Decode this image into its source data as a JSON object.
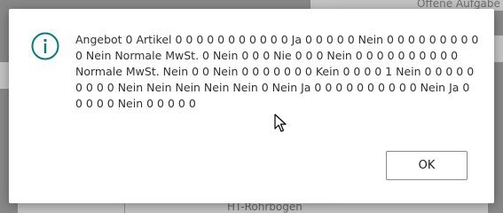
{
  "background": {
    "top_right_text": "Offene Aufgabe",
    "bottom_text": "HT-Rohrbogen"
  },
  "dialog": {
    "icon": "info-icon",
    "message": "Angebot 0 Artikel 0 0 0 0 0 0 0 0 0 0 0 Ja 0 0 0 0 0 Nein 0 0 0 0 0 0 0 0 0 0 Nein Normale MwSt. 0 Nein 0 0 0 Nie 0 0 0 Nein 0 0 0 0 0 0 0 0 0 0 Normale MwSt. Nein 0 0 Nein 0 0 0 0 0 0 0 Kein 0 0 0 0 1 Nein 0 0 0 0 0 0 0 0 0 Nein Nein Nein Nein Nein 0 Nein Ja 0 0 0 0 0 0 0 0 0 0 Nein Ja 0 0 0 0 0 Nein 0 0 0 0 0",
    "ok_label": "OK"
  },
  "colors": {
    "accent": "#0a7a7a",
    "overlay": "#888888"
  }
}
